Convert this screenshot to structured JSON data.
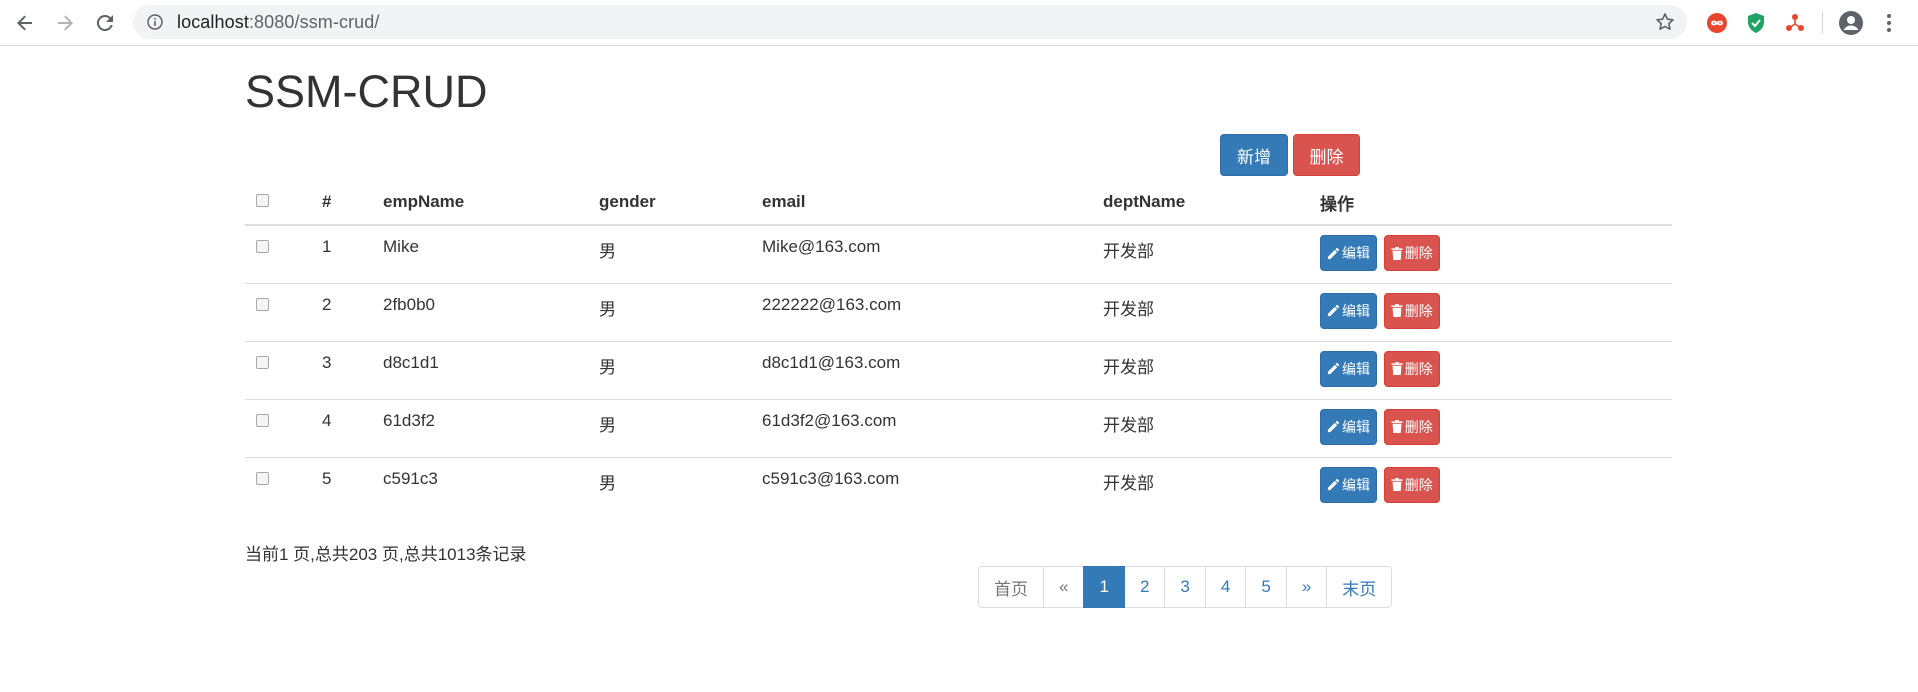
{
  "browser": {
    "url_host": "localhost",
    "url_port": ":8080",
    "url_path": "/ssm-crud/"
  },
  "page": {
    "title": "SSM-CRUD",
    "add_label": "新增",
    "delete_label": "删除"
  },
  "table": {
    "headers": [
      "#",
      "empName",
      "gender",
      "email",
      "deptName",
      "操作"
    ],
    "rows": [
      {
        "id": "1",
        "name": "Mike",
        "gender": "男",
        "email": "Mike@163.com",
        "dept": "开发部"
      },
      {
        "id": "2",
        "name": "2fb0b0",
        "gender": "男",
        "email": "222222@163.com",
        "dept": "开发部"
      },
      {
        "id": "3",
        "name": "d8c1d1",
        "gender": "男",
        "email": "d8c1d1@163.com",
        "dept": "开发部"
      },
      {
        "id": "4",
        "name": "61d3f2",
        "gender": "男",
        "email": "61d3f2@163.com",
        "dept": "开发部"
      },
      {
        "id": "5",
        "name": "c591c3",
        "gender": "男",
        "email": "c591c3@163.com",
        "dept": "开发部"
      }
    ],
    "edit_label": "编辑",
    "row_delete_label": "删除"
  },
  "pagination": {
    "summary": "当前1 页,总共203 页,总共1013条记录",
    "first": "首页",
    "prev": "«",
    "pages": [
      "1",
      "2",
      "3",
      "4",
      "5"
    ],
    "active_page": "1",
    "next": "»",
    "last": "末页"
  },
  "colors": {
    "primary": "#337ab7",
    "danger": "#d9534f"
  }
}
